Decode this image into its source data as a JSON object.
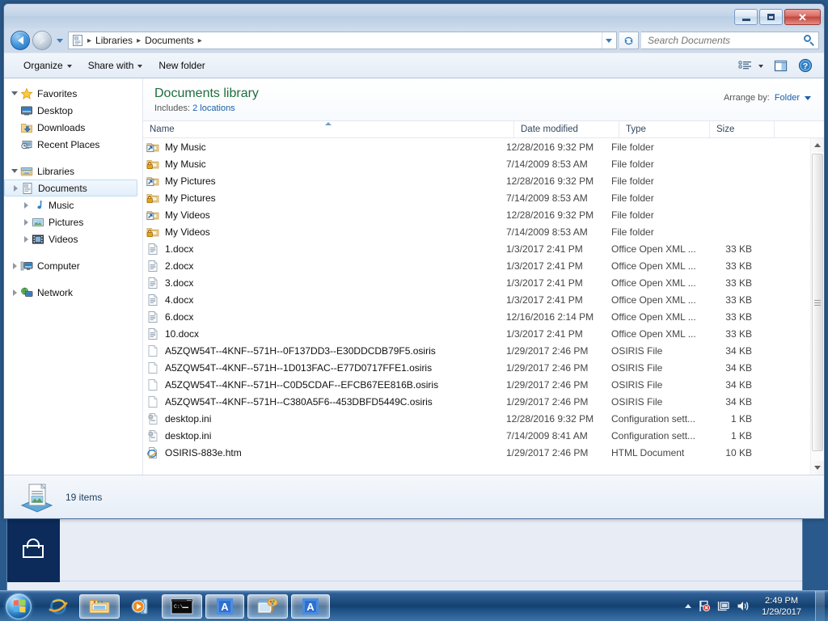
{
  "window": {
    "title": "",
    "minimize_label": "Minimize",
    "maximize_label": "Maximize",
    "close_label": "Close"
  },
  "address": {
    "crumbs": [
      "Libraries",
      "Documents"
    ],
    "separator": "▸",
    "back_label": "Back",
    "forward_label": "Forward",
    "recent_label": "Recent pages",
    "refresh_label": "Refresh"
  },
  "search": {
    "placeholder": "Search Documents",
    "value": ""
  },
  "toolbar": {
    "organize": "Organize",
    "share_with": "Share with",
    "new_folder": "New folder",
    "view_label": "Change your view",
    "preview_label": "Show the preview pane",
    "help_label": "Get help"
  },
  "navpane": {
    "groups": [
      {
        "label": "Favorites",
        "expanded": true,
        "icon": "star-icon",
        "children": [
          {
            "label": "Desktop",
            "icon": "desktop-icon"
          },
          {
            "label": "Downloads",
            "icon": "downloads-icon"
          },
          {
            "label": "Recent Places",
            "icon": "recent-places-icon"
          }
        ]
      },
      {
        "label": "Libraries",
        "expanded": true,
        "icon": "libraries-icon",
        "children": [
          {
            "label": "Documents",
            "icon": "documents-icon",
            "selected": true
          },
          {
            "label": "Music",
            "icon": "music-icon"
          },
          {
            "label": "Pictures",
            "icon": "pictures-icon"
          },
          {
            "label": "Videos",
            "icon": "videos-icon"
          }
        ]
      },
      {
        "label": "Computer",
        "expanded": false,
        "icon": "computer-icon",
        "children": []
      },
      {
        "label": "Network",
        "expanded": false,
        "icon": "network-icon",
        "children": []
      }
    ]
  },
  "library": {
    "title": "Documents library",
    "includes_label": "Includes:",
    "includes_link": "2 locations",
    "arrange_label": "Arrange by:",
    "arrange_value": "Folder"
  },
  "columns": {
    "name": "Name",
    "date_modified": "Date modified",
    "type": "Type",
    "size": "Size",
    "sorted_by": "Name",
    "sort_direction": "ascending"
  },
  "files": [
    {
      "name": "My Music",
      "icon": "folder-shortcut-icon",
      "date": "12/28/2016 9:32 PM",
      "type": "File folder",
      "size": ""
    },
    {
      "name": "My Music",
      "icon": "folder-locked-icon",
      "date": "7/14/2009 8:53 AM",
      "type": "File folder",
      "size": ""
    },
    {
      "name": "My Pictures",
      "icon": "folder-shortcut-icon",
      "date": "12/28/2016 9:32 PM",
      "type": "File folder",
      "size": ""
    },
    {
      "name": "My Pictures",
      "icon": "folder-locked-icon",
      "date": "7/14/2009 8:53 AM",
      "type": "File folder",
      "size": ""
    },
    {
      "name": "My Videos",
      "icon": "folder-shortcut-icon",
      "date": "12/28/2016 9:32 PM",
      "type": "File folder",
      "size": ""
    },
    {
      "name": "My Videos",
      "icon": "folder-locked-icon",
      "date": "7/14/2009 8:53 AM",
      "type": "File folder",
      "size": ""
    },
    {
      "name": "1.docx",
      "icon": "docx-icon",
      "date": "1/3/2017 2:41 PM",
      "type": "Office Open XML ...",
      "size": "33 KB"
    },
    {
      "name": "2.docx",
      "icon": "docx-icon",
      "date": "1/3/2017 2:41 PM",
      "type": "Office Open XML ...",
      "size": "33 KB"
    },
    {
      "name": "3.docx",
      "icon": "docx-icon",
      "date": "1/3/2017 2:41 PM",
      "type": "Office Open XML ...",
      "size": "33 KB"
    },
    {
      "name": "4.docx",
      "icon": "docx-icon",
      "date": "1/3/2017 2:41 PM",
      "type": "Office Open XML ...",
      "size": "33 KB"
    },
    {
      "name": "6.docx",
      "icon": "docx-icon",
      "date": "12/16/2016 2:14 PM",
      "type": "Office Open XML ...",
      "size": "33 KB"
    },
    {
      "name": "10.docx",
      "icon": "docx-icon",
      "date": "1/3/2017 2:41 PM",
      "type": "Office Open XML ...",
      "size": "33 KB"
    },
    {
      "name": "A5ZQW54T--4KNF--571H--0F137DD3--E30DDCDB79F5.osiris",
      "icon": "blank-file-icon",
      "date": "1/29/2017 2:46 PM",
      "type": "OSIRIS File",
      "size": "34 KB"
    },
    {
      "name": "A5ZQW54T--4KNF--571H--1D013FAC--E77D0717FFE1.osiris",
      "icon": "blank-file-icon",
      "date": "1/29/2017 2:46 PM",
      "type": "OSIRIS File",
      "size": "34 KB"
    },
    {
      "name": "A5ZQW54T--4KNF--571H--C0D5CDAF--EFCB67EE816B.osiris",
      "icon": "blank-file-icon",
      "date": "1/29/2017 2:46 PM",
      "type": "OSIRIS File",
      "size": "34 KB"
    },
    {
      "name": "A5ZQW54T--4KNF--571H--C380A5F6--453DBFD5449C.osiris",
      "icon": "blank-file-icon",
      "date": "1/29/2017 2:46 PM",
      "type": "OSIRIS File",
      "size": "34 KB"
    },
    {
      "name": "desktop.ini",
      "icon": "ini-icon",
      "date": "12/28/2016 9:32 PM",
      "type": "Configuration sett...",
      "size": "1 KB"
    },
    {
      "name": "desktop.ini",
      "icon": "ini-icon",
      "date": "7/14/2009 8:41 AM",
      "type": "Configuration sett...",
      "size": "1 KB"
    },
    {
      "name": "OSIRIS-883e.htm",
      "icon": "html-icon",
      "date": "1/29/2017 2:46 PM",
      "type": "HTML Document",
      "size": "10 KB"
    }
  ],
  "status": {
    "item_count": "19 items"
  },
  "taskbar": {
    "start_label": "Start",
    "buttons": [
      {
        "name": "internet-explorer",
        "label": "Internet Explorer",
        "active": false,
        "quick": true
      },
      {
        "name": "windows-explorer",
        "label": "Windows Explorer",
        "active": true,
        "quick": false
      },
      {
        "name": "media-player",
        "label": "Windows Media Player",
        "active": false,
        "quick": true
      },
      {
        "name": "command-prompt",
        "label": "Command Prompt",
        "active": true,
        "quick": false
      },
      {
        "name": "app-a-1",
        "label": "A",
        "active": true,
        "quick": false
      },
      {
        "name": "paint-app",
        "label": "Paint",
        "active": true,
        "quick": false
      },
      {
        "name": "app-a-2",
        "label": "A",
        "active": true,
        "quick": false
      }
    ],
    "tray": {
      "show_hidden_label": "Show hidden icons",
      "action_center_label": "Action Center",
      "network_label": "Network",
      "volume_label": "Volume"
    },
    "clock": {
      "time": "2:49 PM",
      "date": "1/29/2017"
    },
    "show_desktop_label": "Show desktop"
  },
  "colors": {
    "library_title": "#1f6e3c",
    "link": "#1a5fa8",
    "taskbar": "#13406f",
    "selection": "#e2eef9",
    "close_button": "#c2453c"
  }
}
